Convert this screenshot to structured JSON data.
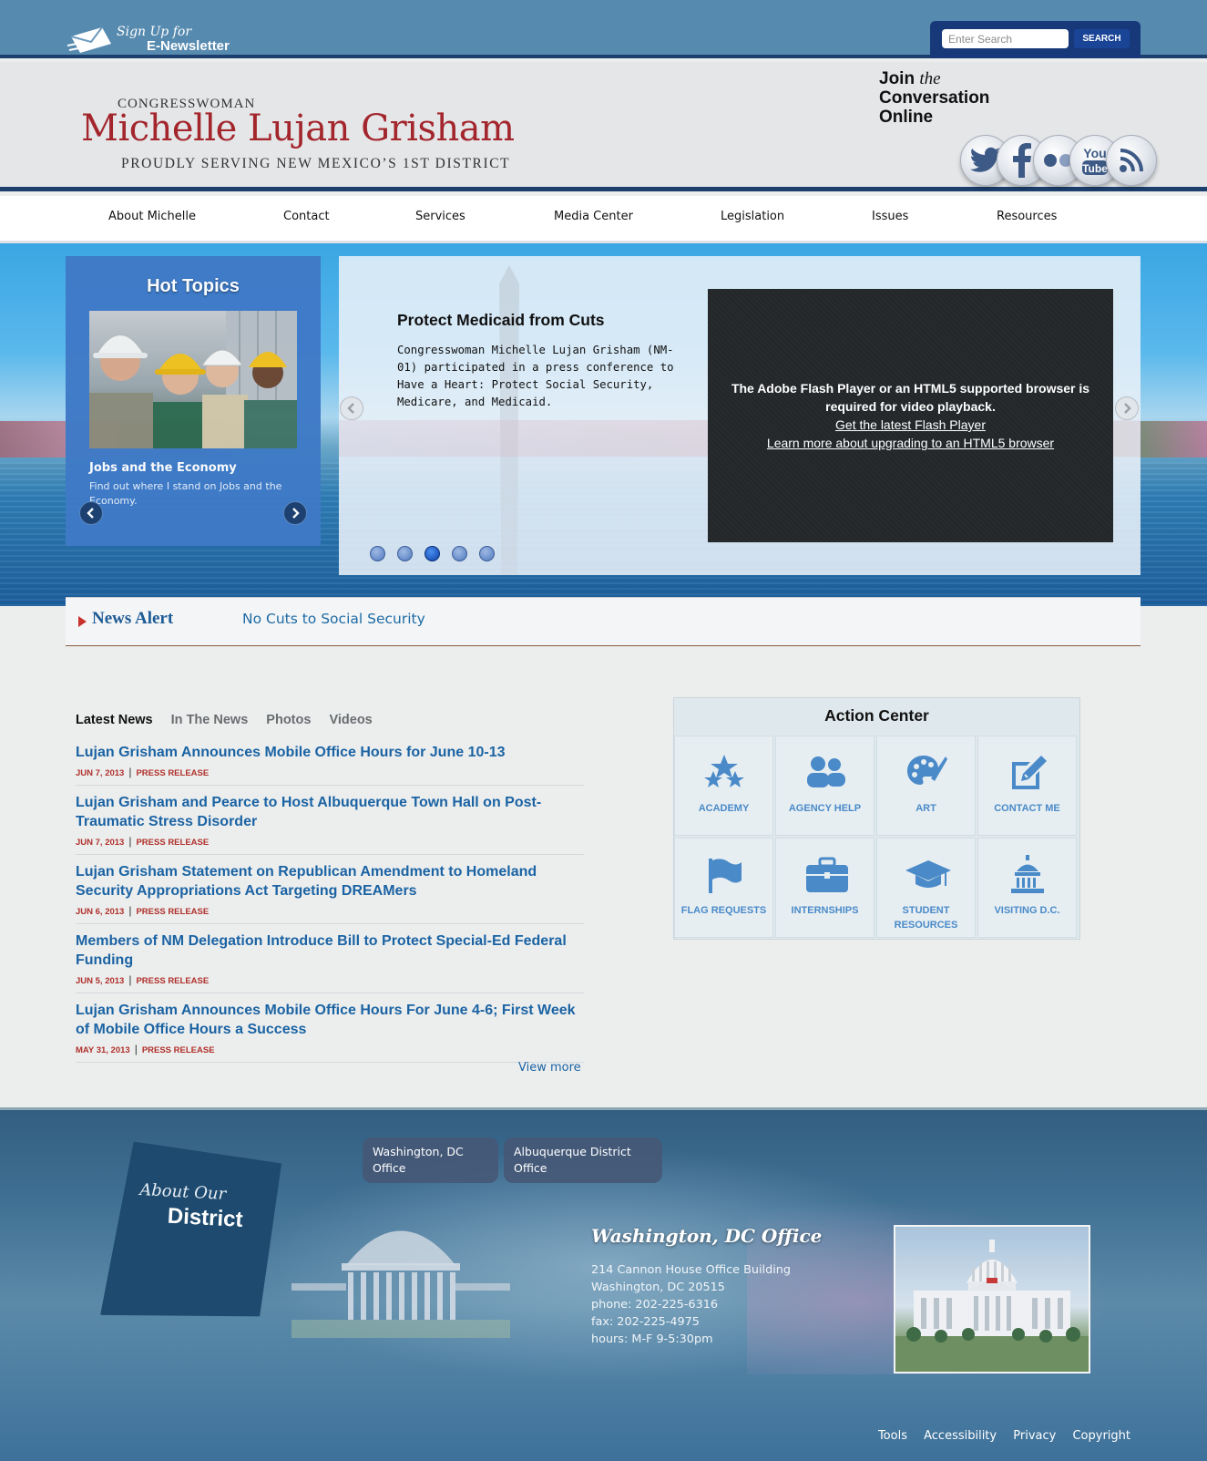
{
  "top": {
    "newsletter": {
      "line1": "Sign Up for",
      "line2": "E-Newsletter",
      "icon": "envelope-icon"
    },
    "search": {
      "placeholder": "Enter Search",
      "button": "SEARCH"
    }
  },
  "header": {
    "title_prefix": "CONGRESSWOMAN",
    "name": "Michelle Lujan Grisham",
    "tagline": "PROUDLY SERVING NEW MEXICO’S 1ST DISTRICT",
    "join": {
      "word1": "Join",
      "word2": "the",
      "word3": "Conversation",
      "word4": "Online"
    },
    "social": [
      "twitter-icon",
      "facebook-icon",
      "flickr-icon",
      "youtube-icon",
      "rss-icon"
    ]
  },
  "nav": [
    "About Michelle",
    "Contact",
    "Services",
    "Media Center",
    "Legislation",
    "Issues",
    "Resources"
  ],
  "hot_topics": {
    "heading": "Hot Topics",
    "item_title": "Jobs and the Economy",
    "item_desc": "Find out where I stand on Jobs and the Economy."
  },
  "slide": {
    "title": "Protect Medicaid from Cuts",
    "body": "Congresswoman Michelle Lujan Grisham (NM-01) participated in a press conference to Have a Heart: Protect Social Security, Medicare, and Medicaid.",
    "video_message": "The Adobe Flash Player or an HTML5 supported browser is required for video playback.",
    "video_link1": "Get the latest Flash Player",
    "video_link2": "Learn more about upgrading to an HTML5 browser",
    "dots_count": 5,
    "active_dot": 3
  },
  "alert": {
    "label": "News Alert",
    "text": "No Cuts to Social Security"
  },
  "news": {
    "tabs": [
      "Latest News",
      "In The News",
      "Photos",
      "Videos"
    ],
    "active_tab": 0,
    "items": [
      {
        "title": "Lujan Grisham Announces Mobile Office Hours for June 10-13",
        "date": "JUN 7, 2013",
        "type": "PRESS RELEASE"
      },
      {
        "title": "Lujan Grisham and Pearce to Host Albuquerque Town Hall on Post-Traumatic Stress Disorder",
        "date": "JUN 7, 2013",
        "type": "PRESS RELEASE"
      },
      {
        "title": "Lujan Grisham Statement on Republican Amendment to Homeland Security Appropriations Act Targeting DREAMers",
        "date": "JUN 6, 2013",
        "type": "PRESS RELEASE"
      },
      {
        "title": "Members of NM Delegation Introduce Bill to Protect Special-Ed Federal Funding",
        "date": "JUN 5, 2013",
        "type": "PRESS RELEASE"
      },
      {
        "title": "Lujan Grisham Announces Mobile Office Hours For June 4-6; First Week of Mobile Office Hours a Success",
        "date": "MAY 31, 2013",
        "type": "PRESS RELEASE"
      }
    ],
    "view_more": "View more"
  },
  "action_center": {
    "heading": "Action Center",
    "tiles": [
      {
        "label": "ACADEMY",
        "icon": "stars-icon"
      },
      {
        "label": "AGENCY HELP",
        "icon": "people-icon"
      },
      {
        "label": "ART",
        "icon": "palette-icon"
      },
      {
        "label": "CONTACT ME",
        "icon": "edit-icon"
      },
      {
        "label": "FLAG REQUESTS",
        "icon": "flag-icon"
      },
      {
        "label": "INTERNSHIPS",
        "icon": "briefcase-icon"
      },
      {
        "label": "STUDENT RESOURCES",
        "icon": "graduation-cap-icon"
      },
      {
        "label": "VISITING D.C.",
        "icon": "capitol-icon"
      }
    ]
  },
  "footer": {
    "district_line1": "About Our",
    "district_line2": "District",
    "office_tabs": [
      "Washington, DC Office",
      "Albuquerque District Office"
    ],
    "office_title": "Washington, DC Office",
    "address": [
      "214 Cannon House Office Building",
      "Washington, DC 20515",
      "phone: 202-225-6316",
      "fax: 202-225-4975",
      "hours: M-F 9-5:30pm"
    ],
    "links": [
      "Tools",
      "Accessibility",
      "Privacy",
      "Copyright"
    ]
  },
  "colors": {
    "topbar": "#568aaf",
    "navy": "#1c3f6e",
    "brand_red": "#a3262d",
    "link_blue": "#1b63a3",
    "meta_red": "#b0302a",
    "tile_icon": "#4a8ac8"
  }
}
